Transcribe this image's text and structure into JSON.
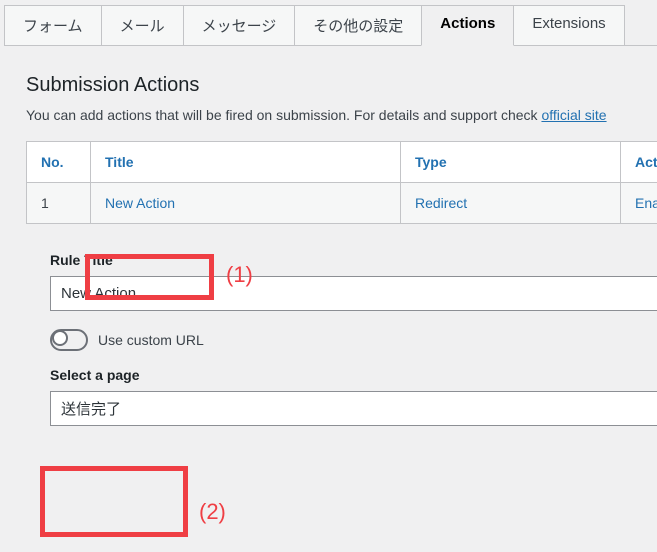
{
  "tabs": {
    "form": "フォーム",
    "mail": "メール",
    "messages": "メッセージ",
    "other": "その他の設定",
    "actions": "Actions",
    "extensions": "Extensions"
  },
  "heading": "Submission Actions",
  "desc_pre": "You can add actions that will be fired on submission. For details and support check ",
  "desc_link": "official site",
  "table": {
    "head": {
      "no": "No.",
      "title": "Title",
      "type": "Type",
      "active": "Active"
    },
    "row": {
      "no": "1",
      "title": "New Action",
      "type": "Redirect",
      "active": "Enabled"
    }
  },
  "rule_title_label": "Rule Title",
  "rule_title_value": "New Action",
  "custom_url_label": "Use custom URL",
  "select_page_label": "Select a page",
  "select_page_value": "送信完了",
  "annotations": {
    "one": "(1)",
    "two": "(2)"
  }
}
